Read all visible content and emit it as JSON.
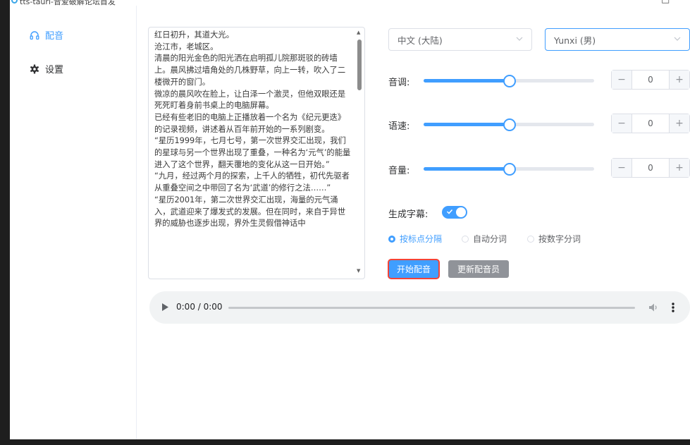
{
  "window": {
    "title": "tts-tauri-音爱破解论坛首发"
  },
  "sidebar": {
    "items": [
      {
        "label": "配音",
        "icon": "headphones-icon",
        "active": true
      },
      {
        "label": "设置",
        "icon": "gear-icon",
        "active": false
      }
    ]
  },
  "text_input": {
    "value": "红日初升，其道大光。\n沧江市，老城区。\n清晨的阳光金色的阳光洒在启明孤儿院那斑驳的砖墙上。晨风拂过墙角处的几株野草，向上一转，吹入了二楼微开的窗门。\n微凉的晨风吹在脸上，让白泽一个激灵，但他双眼还是死死盯着身前书桌上的电脑屏幕。\n已经有些老旧的电脑上正播放着一个名为《纪元更迭》的记录视频，讲述着从百年前开始的一系列剧变。\n“星历1999年，七月七号，第一次世界交汇出现，我们的星球与另一个世界出现了重叠，一种名为‘元气’的能量进入了这个世界，翻天覆地的变化从这一日开始。”\n“九月，经过两个月的探索，上千人的牺牲，初代先驱者从重叠空间之中带回了名为‘武道’的修行之法……”\n“星历2001年，第二次世界交汇出现，海量的元气涌入，武道迎来了爆发式的发展。但在同时，来自于异世界的威胁也逐步出现，界外生灵假借神话中"
  },
  "language_select": {
    "value": "中文 (大陆)"
  },
  "voice_select": {
    "value": "Yunxi (男)"
  },
  "params": [
    {
      "label": "音调:",
      "value": "0",
      "slider_fraction": 0.5
    },
    {
      "label": "语速:",
      "value": "0",
      "slider_fraction": 0.5
    },
    {
      "label": "音量:",
      "value": "0",
      "slider_fraction": 0.5
    }
  ],
  "stepper": {
    "minus": "−",
    "plus": "+"
  },
  "subtitle": {
    "label": "生成字幕:",
    "enabled": true
  },
  "split_options": [
    {
      "label": "按标点分隔",
      "checked": true
    },
    {
      "label": "自动分词",
      "checked": false
    },
    {
      "label": "按数字分词",
      "checked": false
    }
  ],
  "buttons": {
    "start": "开始配音",
    "update": "更新配音员"
  },
  "audio": {
    "time": "0:00 / 0:00"
  },
  "colors": {
    "primary": "#409eff",
    "info": "#909399",
    "highlight": "#f44336"
  }
}
